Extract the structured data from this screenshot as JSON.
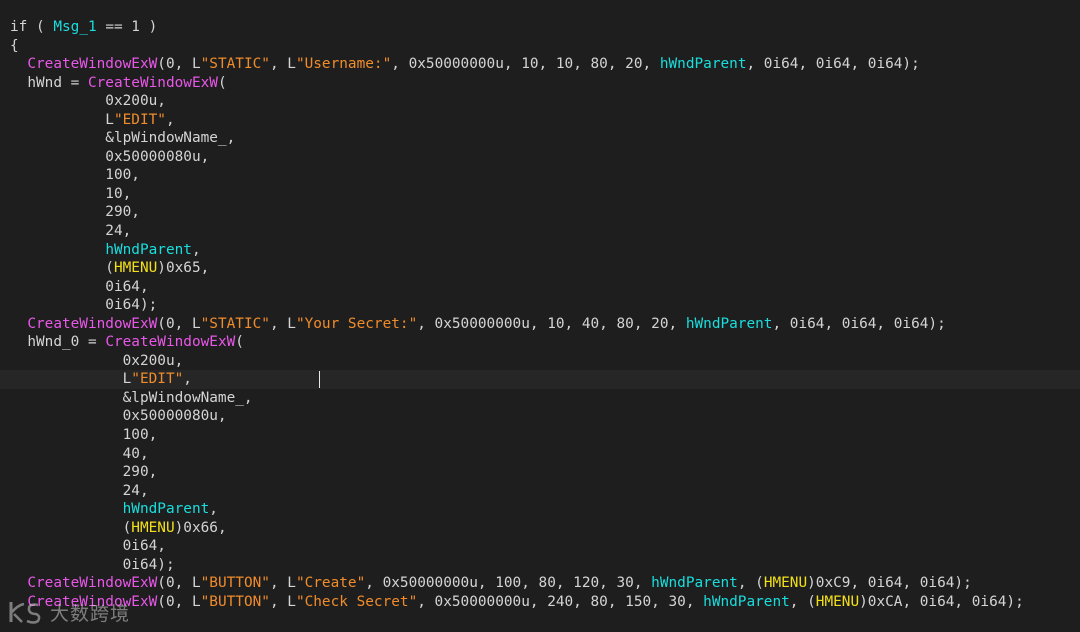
{
  "editor": {
    "caret_line": 19,
    "lines": [
      [
        {
          "t": "if ( ",
          "c": "plain"
        },
        {
          "t": "Msg_1",
          "c": "var"
        },
        {
          "t": " == 1 )",
          "c": "plain"
        }
      ],
      [
        {
          "t": "{",
          "c": "plain"
        }
      ],
      [
        {
          "t": "  ",
          "c": "plain"
        },
        {
          "t": "CreateWindowExW",
          "c": "fn"
        },
        {
          "t": "(0, L",
          "c": "plain"
        },
        {
          "t": "\"STATIC\"",
          "c": "str"
        },
        {
          "t": ", L",
          "c": "plain"
        },
        {
          "t": "\"Username:\"",
          "c": "str"
        },
        {
          "t": ", 0x50000000u, 10, 10, 80, 20, ",
          "c": "plain"
        },
        {
          "t": "hWndParent",
          "c": "var"
        },
        {
          "t": ", 0i64, 0i64, 0i64);",
          "c": "plain"
        }
      ],
      [
        {
          "t": "  hWnd = ",
          "c": "plain"
        },
        {
          "t": "CreateWindowExW",
          "c": "fn"
        },
        {
          "t": "(",
          "c": "plain"
        }
      ],
      [
        {
          "t": "           0x200u,",
          "c": "plain"
        }
      ],
      [
        {
          "t": "           L",
          "c": "plain"
        },
        {
          "t": "\"EDIT\"",
          "c": "str"
        },
        {
          "t": ",",
          "c": "plain"
        }
      ],
      [
        {
          "t": "           &lpWindowName_,",
          "c": "plain"
        }
      ],
      [
        {
          "t": "           0x50000080u,",
          "c": "plain"
        }
      ],
      [
        {
          "t": "           100,",
          "c": "plain"
        }
      ],
      [
        {
          "t": "           10,",
          "c": "plain"
        }
      ],
      [
        {
          "t": "           290,",
          "c": "plain"
        }
      ],
      [
        {
          "t": "           24,",
          "c": "plain"
        }
      ],
      [
        {
          "t": "           ",
          "c": "plain"
        },
        {
          "t": "hWndParent",
          "c": "var"
        },
        {
          "t": ",",
          "c": "plain"
        }
      ],
      [
        {
          "t": "           (",
          "c": "plain"
        },
        {
          "t": "HMENU",
          "c": "type"
        },
        {
          "t": ")0x65,",
          "c": "plain"
        }
      ],
      [
        {
          "t": "           0i64,",
          "c": "plain"
        }
      ],
      [
        {
          "t": "           0i64);",
          "c": "plain"
        }
      ],
      [
        {
          "t": "  ",
          "c": "plain"
        },
        {
          "t": "CreateWindowExW",
          "c": "fn"
        },
        {
          "t": "(0, L",
          "c": "plain"
        },
        {
          "t": "\"STATIC\"",
          "c": "str"
        },
        {
          "t": ", L",
          "c": "plain"
        },
        {
          "t": "\"Your Secret:\"",
          "c": "str"
        },
        {
          "t": ", 0x50000000u, 10, 40, 80, 20, ",
          "c": "plain"
        },
        {
          "t": "hWndParent",
          "c": "var"
        },
        {
          "t": ", 0i64, 0i64, 0i64);",
          "c": "plain"
        }
      ],
      [
        {
          "t": "  hWnd_0 = ",
          "c": "plain"
        },
        {
          "t": "CreateWindowExW",
          "c": "fn"
        },
        {
          "t": "(",
          "c": "plain"
        }
      ],
      [
        {
          "t": "             0x200u,",
          "c": "plain"
        }
      ],
      [
        {
          "t": "             L",
          "c": "plain"
        },
        {
          "t": "\"EDIT\"",
          "c": "str"
        },
        {
          "t": ",",
          "c": "plain"
        }
      ],
      [
        {
          "t": "             &lpWindowName_,",
          "c": "plain"
        }
      ],
      [
        {
          "t": "             0x50000080u,",
          "c": "plain"
        }
      ],
      [
        {
          "t": "             100,",
          "c": "plain"
        }
      ],
      [
        {
          "t": "             40,",
          "c": "plain"
        }
      ],
      [
        {
          "t": "             290,",
          "c": "plain"
        }
      ],
      [
        {
          "t": "             24,",
          "c": "plain"
        }
      ],
      [
        {
          "t": "             ",
          "c": "plain"
        },
        {
          "t": "hWndParent",
          "c": "var"
        },
        {
          "t": ",",
          "c": "plain"
        }
      ],
      [
        {
          "t": "             (",
          "c": "plain"
        },
        {
          "t": "HMENU",
          "c": "type"
        },
        {
          "t": ")0x66,",
          "c": "plain"
        }
      ],
      [
        {
          "t": "             0i64,",
          "c": "plain"
        }
      ],
      [
        {
          "t": "             0i64);",
          "c": "plain"
        }
      ],
      [
        {
          "t": "  ",
          "c": "plain"
        },
        {
          "t": "CreateWindowExW",
          "c": "fn"
        },
        {
          "t": "(0, L",
          "c": "plain"
        },
        {
          "t": "\"BUTTON\"",
          "c": "str"
        },
        {
          "t": ", L",
          "c": "plain"
        },
        {
          "t": "\"Create\"",
          "c": "str"
        },
        {
          "t": ", 0x50000000u, 100, 80, 120, 30, ",
          "c": "plain"
        },
        {
          "t": "hWndParent",
          "c": "var"
        },
        {
          "t": ", (",
          "c": "plain"
        },
        {
          "t": "HMENU",
          "c": "type"
        },
        {
          "t": ")0xC9, 0i64, 0i64);",
          "c": "plain"
        }
      ],
      [
        {
          "t": "  ",
          "c": "plain"
        },
        {
          "t": "CreateWindowExW",
          "c": "fn"
        },
        {
          "t": "(0, L",
          "c": "plain"
        },
        {
          "t": "\"BUTTON\"",
          "c": "str"
        },
        {
          "t": ", L",
          "c": "plain"
        },
        {
          "t": "\"Check Secret\"",
          "c": "str"
        },
        {
          "t": ", 0x50000000u, 240, 80, 150, 30, ",
          "c": "plain"
        },
        {
          "t": "hWndParent",
          "c": "var"
        },
        {
          "t": ", (",
          "c": "plain"
        },
        {
          "t": "HMENU",
          "c": "type"
        },
        {
          "t": ")0xCA, 0i64, 0i64);",
          "c": "plain"
        }
      ]
    ]
  },
  "syntax_colors": {
    "function": "#e957e9",
    "string": "#f08c2b",
    "variable": "#19dede",
    "type": "#f3e01a",
    "default": "#d4d4d4",
    "background": "#1e1e1e",
    "current_line": "#262626"
  },
  "watermark": {
    "text": "大数跨境",
    "icon": "ks-logo-icon"
  }
}
